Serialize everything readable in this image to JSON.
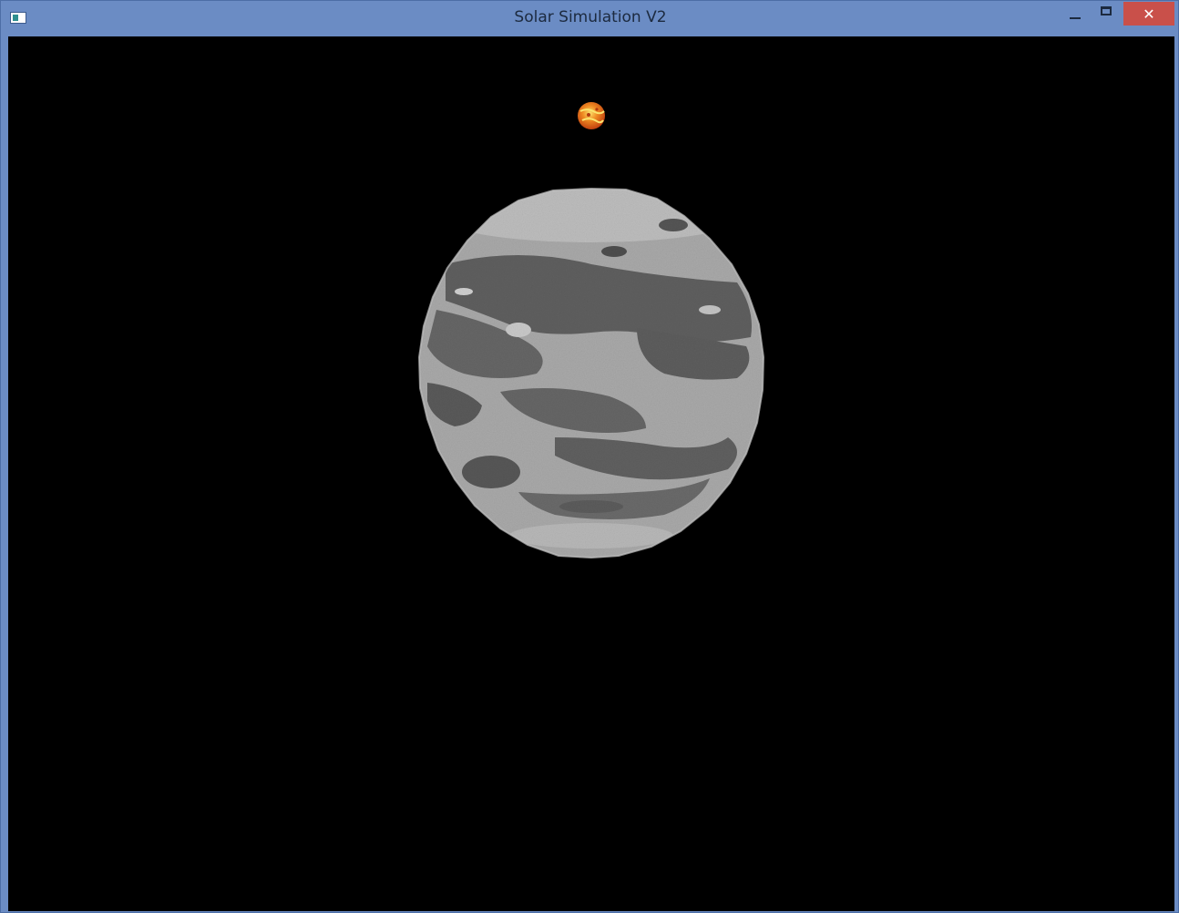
{
  "window": {
    "title": "Solar Simulation V2",
    "icons": {
      "app": "app-window-icon",
      "minimize": "minimize-icon",
      "maximize": "maximize-icon",
      "close": "close-icon"
    },
    "close_glyph": "✕"
  },
  "scene": {
    "background_color": "#000000",
    "bodies": [
      {
        "name": "sun",
        "colors": [
          "#f7c23a",
          "#e8661a",
          "#b73a10"
        ]
      },
      {
        "name": "moon",
        "colors": [
          "#c8c8c8",
          "#8a8a8a",
          "#5a5a5a"
        ]
      }
    ]
  }
}
